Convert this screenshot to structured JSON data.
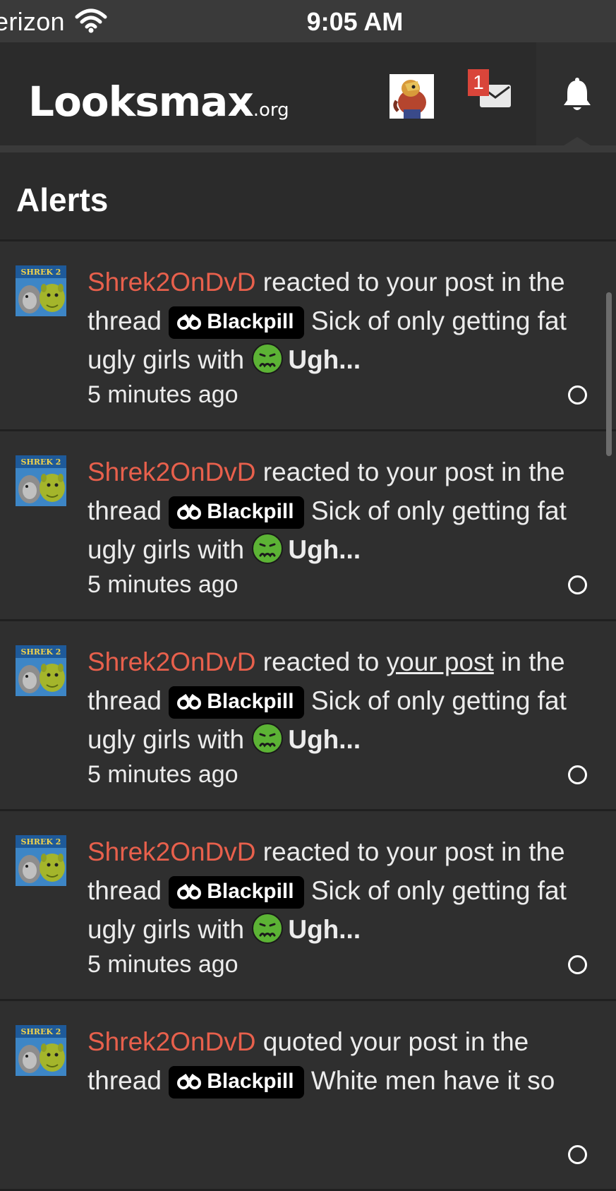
{
  "status_bar": {
    "carrier": "erizon",
    "time": "9:05 AM"
  },
  "header": {
    "logo_main": "Looksmax",
    "logo_tld": ".org",
    "mail_badge_count": "1"
  },
  "alerts": {
    "title": "Alerts",
    "items": [
      {
        "username": "Shrek2OnDvD",
        "action_pre": " reacted to ",
        "action_link": "your post",
        "action_post": " in the thread ",
        "tag": "Blackpill",
        "thread_title": " Sick of only getting fat ugly girls with ",
        "thread_end": "Ugh...",
        "time": "5 minutes ago",
        "underlined": false
      },
      {
        "username": "Shrek2OnDvD",
        "action_pre": " reacted to ",
        "action_link": "your post",
        "action_post": " in the thread ",
        "tag": "Blackpill",
        "thread_title": " Sick of only getting fat ugly girls with ",
        "thread_end": "Ugh...",
        "time": "5 minutes ago",
        "underlined": false
      },
      {
        "username": "Shrek2OnDvD",
        "action_pre": " reacted to ",
        "action_link": "your post",
        "action_post": " in the thread ",
        "tag": "Blackpill",
        "thread_title": " Sick of only getting fat ugly girls with ",
        "thread_end": "Ugh...",
        "time": "5 minutes ago",
        "underlined": true
      },
      {
        "username": "Shrek2OnDvD",
        "action_pre": " reacted to ",
        "action_link": "your post",
        "action_post": " in the thread ",
        "tag": "Blackpill",
        "thread_title": " Sick of only getting fat ugly girls with ",
        "thread_end": "Ugh...",
        "time": "5 minutes ago",
        "underlined": false
      },
      {
        "username": "Shrek2OnDvD",
        "action_pre": " quoted ",
        "action_link": "your post",
        "action_post": " in the thread ",
        "tag": "Blackpill",
        "thread_title": " White men have it so",
        "thread_end": "",
        "time": "",
        "underlined": false
      }
    ]
  },
  "colors": {
    "username": "#e8604c",
    "background": "#2b2b2b",
    "badge": "#d9453a",
    "tag_bg": "#000000",
    "emoji_green": "#5cb335"
  },
  "icons": [
    "wifi-icon",
    "mail-icon",
    "bell-icon",
    "binoculars-icon",
    "nauseated-face-icon",
    "avatar-shrek",
    "mark-read-circle-icon"
  ]
}
